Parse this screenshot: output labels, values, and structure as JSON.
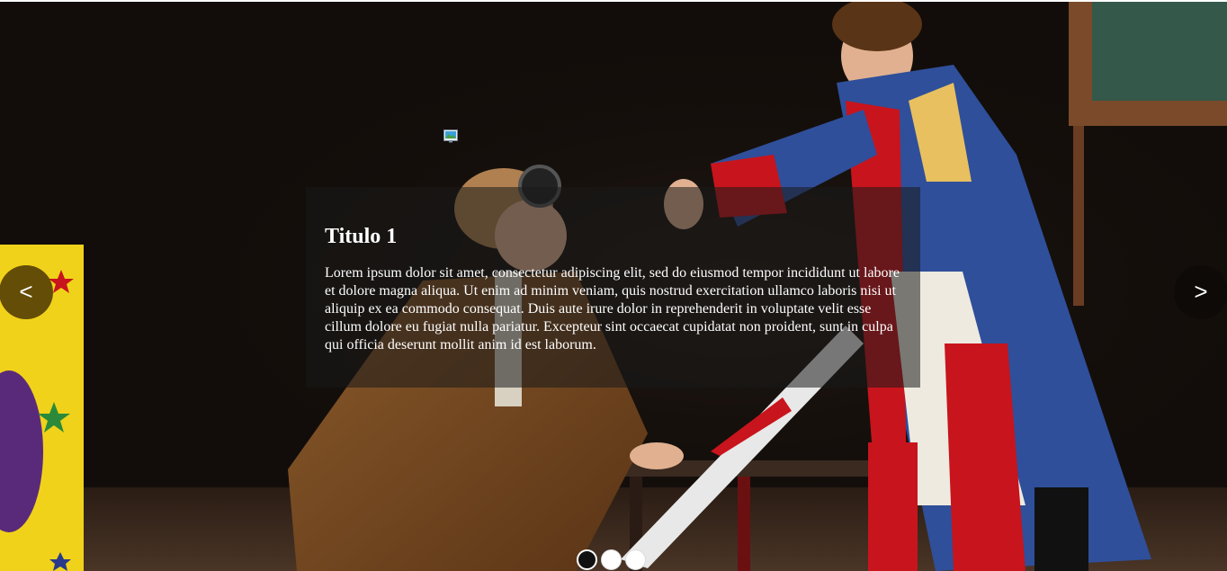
{
  "slider": {
    "image_alt": "Theatre scene: an aviator kneeling by a table and a prince in a blue coat",
    "active_index": 0,
    "prev_label": "<",
    "next_label": ">",
    "dots": [
      {
        "active": true
      },
      {
        "active": false
      },
      {
        "active": false
      }
    ]
  },
  "caption": {
    "title": "Titulo 1",
    "text": "Lorem ipsum dolor sit amet, consectetur adipiscing elit, sed do eiusmod tempor incididunt ut labore et dolore magna aliqua. Ut enim ad minim veniam, quis nostrud exercitation ullamco laboris nisi ut aliquip ex ea commodo consequat. Duis aute irure dolor in reprehenderit in voluptate velit esse cillum dolore eu fugiat nulla pariatur. Excepteur sint occaecat cupidatat non proident, sunt in culpa qui officia deserunt mollit anim id est laborum."
  },
  "icons": {
    "broken_image": "broken-image-icon"
  },
  "colors": {
    "prev_button": "#503a05",
    "caption_bg": "#191919",
    "costume_blue": "#2f4f9a",
    "costume_red": "#c8141c",
    "prop_yellow": "#f0d21a"
  }
}
